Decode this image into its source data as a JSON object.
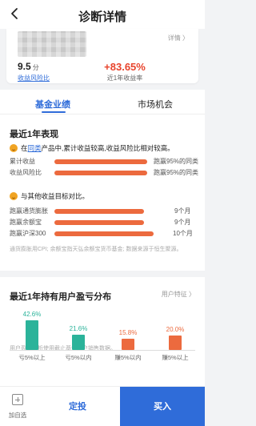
{
  "nav": {
    "title": "诊断详情"
  },
  "card": {
    "detail_link": "详情 〉",
    "risk_value": "9.5",
    "risk_unit": "分",
    "risk_label": "收益风险比",
    "return_value": "+83.65%",
    "return_label": "近1年收益率"
  },
  "tabs": [
    {
      "label": "基金业绩",
      "active": true
    },
    {
      "label": "市场机会",
      "active": false
    }
  ],
  "performance": {
    "title": "最近1年表现",
    "statement1": {
      "prefix": "在",
      "link": "同类",
      "suffix": "产品中,累计收益较高,收益风险比相对较高。"
    },
    "peer_rows": [
      {
        "label": "累计收益",
        "value": "跑赢95%的同类",
        "fill_pct": 95
      },
      {
        "label": "收益风险比",
        "value": "跑赢95%的同类",
        "fill_pct": 95
      }
    ],
    "statement2": "与其他收益目标对比。",
    "benchmark_rows": [
      {
        "label": "跑赢通货膨胀",
        "value": "9个月",
        "fill_pct": 75
      },
      {
        "label": "跑赢余额宝",
        "value": "9个月",
        "fill_pct": 75
      },
      {
        "label": "跑赢沪深300",
        "value": "10个月",
        "fill_pct": 83
      }
    ],
    "note": "通货膨胀用CPI; 余额宝指天弘余额宝货币基金; 数据来源于恒生聚源。"
  },
  "distribution": {
    "title": "最近1年持有用户盈亏分布",
    "feature_link": "用户特征 〉",
    "note": "用户盈亏分析使用截止基金用户销售数据。"
  },
  "chart_data": {
    "type": "bar",
    "categories": [
      "亏5%以上",
      "亏5%以内",
      "赚5%以内",
      "赚5%以上"
    ],
    "values": [
      42.6,
      21.6,
      15.8,
      20.0
    ],
    "value_labels": [
      "42.6%",
      "21.6%",
      "15.8%",
      "20.0%"
    ],
    "colors": [
      "#2bb39a",
      "#2bb39a",
      "#ec6a3e",
      "#ec6a3e"
    ],
    "ylim": [
      0,
      50
    ]
  },
  "bottom_bar": {
    "add_label": "加自选",
    "dingtou_label": "定投",
    "buy_label": "买入"
  },
  "colors": {
    "accent": "#2f6cd9",
    "positive": "#e8442c",
    "bar_orange": "#ec6a3e",
    "bar_green": "#2bb39a"
  }
}
